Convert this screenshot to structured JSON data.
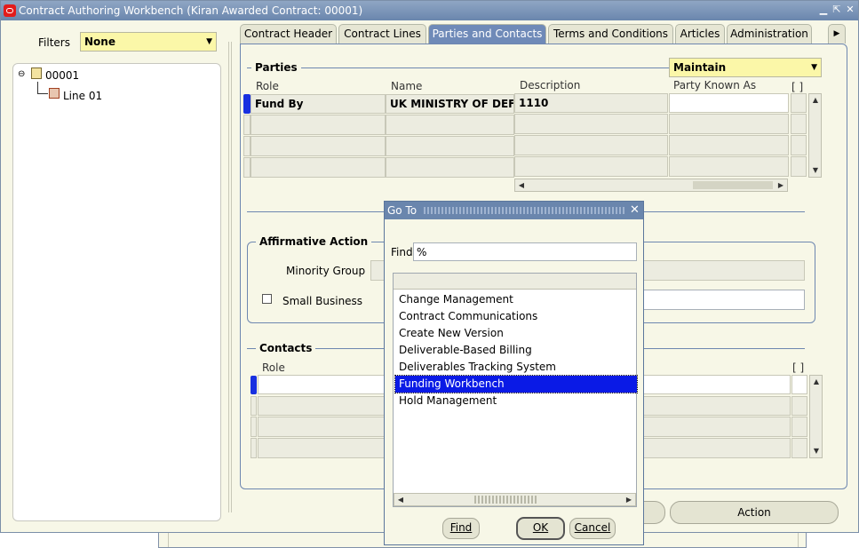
{
  "window": {
    "title": "Contract Authoring Workbench (Kiran Awarded Contract: 00001)"
  },
  "filters": {
    "label": "Filters",
    "value": "None"
  },
  "tree": {
    "root": "00001",
    "child": "Line 01"
  },
  "tabs": [
    "Contract Header",
    "Contract Lines",
    "Parties and Contacts",
    "Terms and Conditions",
    "Articles",
    "Administration"
  ],
  "active_tab": "Parties and Contacts",
  "parties": {
    "section_label": "Parties",
    "mode": "Maintain",
    "columns": {
      "role": "Role",
      "name": "Name",
      "description": "Description",
      "known_as": "Party Known As",
      "flex": "[ ]"
    },
    "rows": [
      {
        "role": "Fund By",
        "name": "UK MINISTRY OF DEFEN",
        "description": "1110",
        "known_as": ""
      }
    ]
  },
  "affirmative": {
    "section_label": "Affirmative Action",
    "minority_group_label": "Minority Group",
    "small_business_label": "Small Business"
  },
  "contacts": {
    "section_label": "Contacts",
    "role_header": "Role",
    "flex": "[ ]"
  },
  "buttons": {
    "action": "Action"
  },
  "goto_dialog": {
    "title": "Go To",
    "find_label": "Find",
    "find_value": "%",
    "items": [
      "Change Management",
      "Contract Communications",
      "Create New Version",
      "Deliverable-Based Billing",
      "Deliverables Tracking System",
      "Funding Workbench",
      "Hold Management"
    ],
    "selected_item": "Funding Workbench",
    "find_button": "Find",
    "ok_button": "OK",
    "cancel_button": "Cancel"
  },
  "colors": {
    "title_bar": "#6a86ad",
    "active_tab": "#6f8ab8",
    "selection": "#0a1ae6",
    "required_field": "#fbf7a8"
  }
}
